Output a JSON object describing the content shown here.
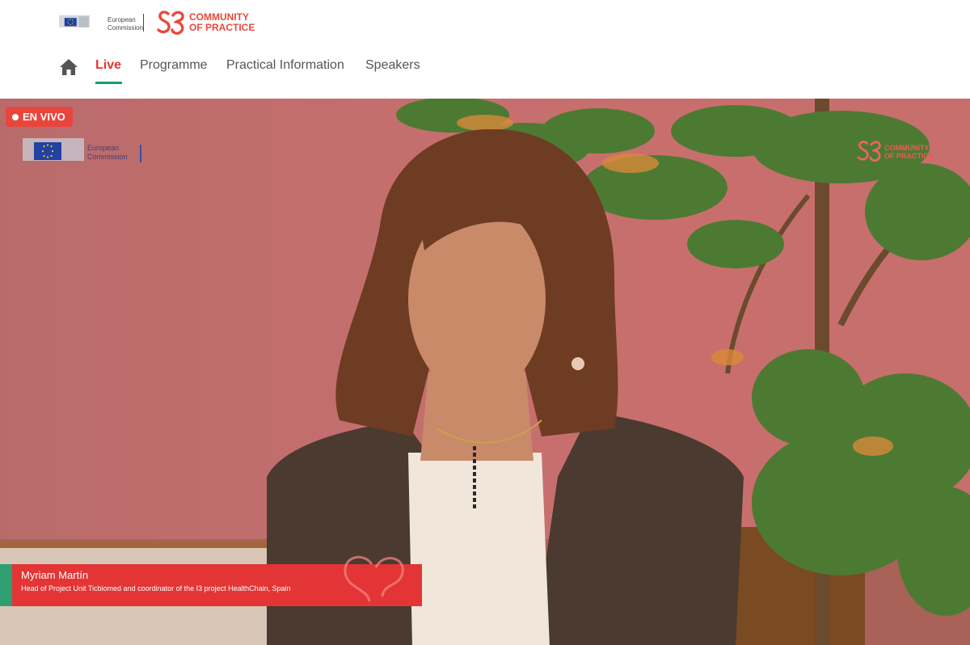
{
  "header": {
    "ec_logo_text": [
      "European",
      "Commission"
    ],
    "cop_logo_text": [
      "COMMUNITY",
      "OF PRACTICE"
    ],
    "cop_symbol": "S3"
  },
  "nav": {
    "items": [
      {
        "label": "Live",
        "active": true
      },
      {
        "label": "Programme",
        "active": false
      },
      {
        "label": "Practical Information",
        "active": false
      },
      {
        "label": "Speakers",
        "active": false
      }
    ]
  },
  "video": {
    "live_badge": "EN VIVO",
    "overlay_ec_text": [
      "European",
      "Commission"
    ],
    "overlay_cop_text": [
      "COMMUNITY",
      "OF PRACTICE"
    ],
    "speaker": {
      "name": "Myriam Martín",
      "role": "Head of Project Unit Ticbiomed and coordinator of the I3 project HealthChain, Spain"
    }
  },
  "colors": {
    "accent_red": "#e8352a",
    "accent_green": "#17a06a",
    "ec_blue": "#0e47cb",
    "lower_third_red": "#e33535"
  }
}
